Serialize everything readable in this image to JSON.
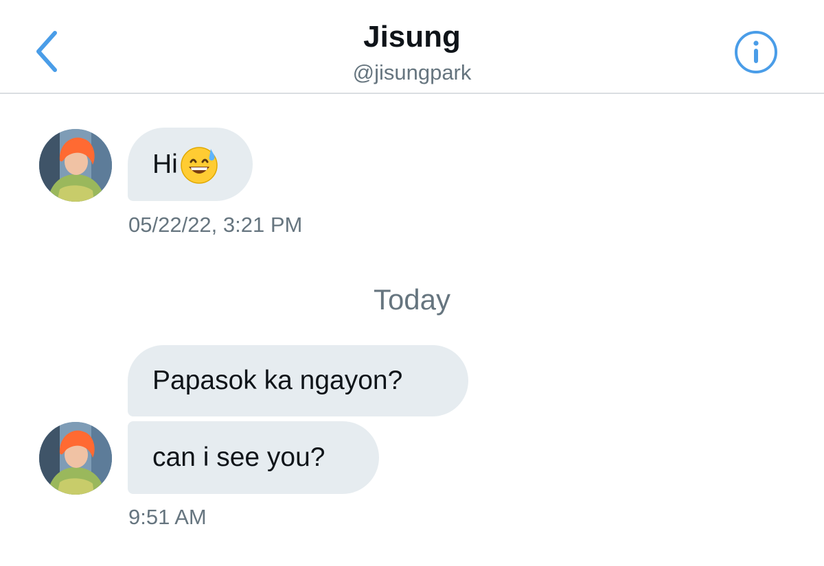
{
  "header": {
    "back_icon": "chevron-left-icon",
    "title": "Jisung",
    "handle": "@jisungpark",
    "info_icon": "info-icon"
  },
  "colors": {
    "accent": "#4a9de8",
    "bubble": "#e6ecf0",
    "muted_text": "#66757f"
  },
  "messages": {
    "first": {
      "text": "Hi",
      "emoji": "grinning-sweat-emoji",
      "timestamp": "05/22/22, 3:21 PM"
    },
    "day_separator": "Today",
    "second": {
      "text": "Papasok ka ngayon?"
    },
    "third": {
      "text": "can i see you?",
      "timestamp": "9:51 AM"
    }
  }
}
